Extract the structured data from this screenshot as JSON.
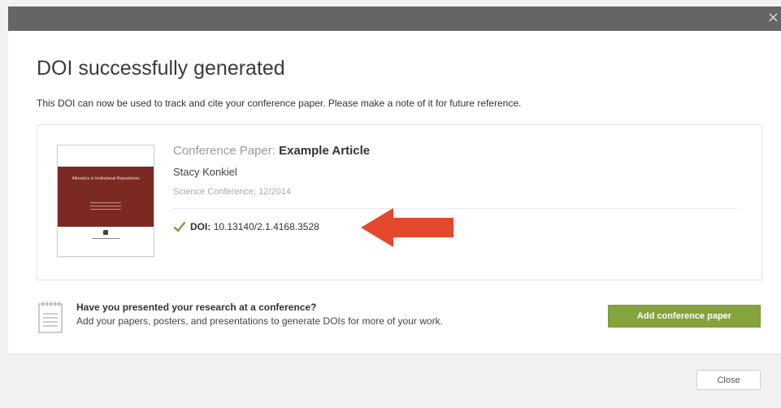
{
  "dialog": {
    "title": "DOI successfully generated",
    "subtitle": "This DOI can now be used to track and cite your conference paper. Please make a note of it for future reference.",
    "close_glyph": "×"
  },
  "paper": {
    "type_label": "Conference Paper:",
    "title": "Example Article",
    "author": "Stacy Konkiel",
    "venue": "Science Conference; 12/2014",
    "doi_label": "DOI:",
    "doi_value": "10.13140/2.1.4168.3528",
    "thumbnail_title": "Altmetrics in Institutional Repositories"
  },
  "promo": {
    "heading": "Have you presented your research at a conference?",
    "text": "Add your papers, posters, and presentations to generate DOIs for more of your work.",
    "button_label": "Add conference paper"
  },
  "footer": {
    "close_label": "Close"
  },
  "icons": {
    "check": "check-icon",
    "arrow": "arrow-left-icon",
    "notepad": "notepad-icon",
    "close": "close-icon"
  },
  "colors": {
    "accent_green": "#86a33c",
    "check_green": "#7ea23c",
    "arrow_red": "#e5482d",
    "thumbnail_red": "#7a2a22",
    "header_gray": "#656565"
  }
}
